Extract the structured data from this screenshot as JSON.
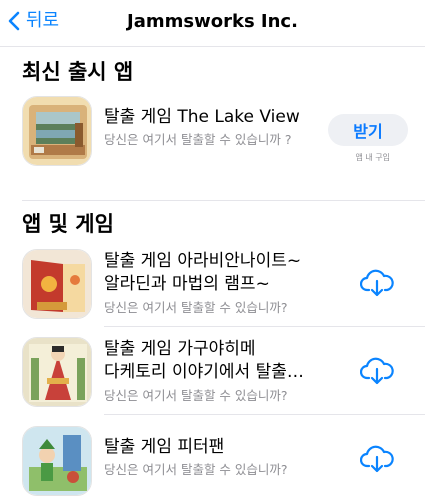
{
  "nav": {
    "back_label": "뒤로",
    "title": "Jammsworks Inc."
  },
  "latest": {
    "section_title": "최신 출시 앱",
    "app": {
      "title": "탈출 게임 The Lake View",
      "subtitle": "당신은 여기서 탈출할 수 있습니까 ?",
      "get_label": "받기",
      "iap_note": "앱 내 구입"
    }
  },
  "apps": {
    "section_title": "앱 및 게임",
    "items": [
      {
        "title_line1": "탈출 게임 아라비안나이트~",
        "title_line2": "알라딘과 마법의 램프~",
        "subtitle": "당신은 여기서 탈출할 수 있습니까?"
      },
      {
        "title_line1": "탈출 게임 가구야히메",
        "title_line2": "다케토리 이야기에서 탈출…",
        "subtitle": "당신은 여기서 탈출할 수 있습니까?"
      },
      {
        "title_line1": "탈출 게임 피터팬",
        "subtitle": "당신은 여기서 탈출할 수 있습니까?"
      }
    ]
  },
  "colors": {
    "accent": "#0a84ff",
    "secondary_text": "#8e8e93",
    "button_bg": "#eef0f4"
  }
}
